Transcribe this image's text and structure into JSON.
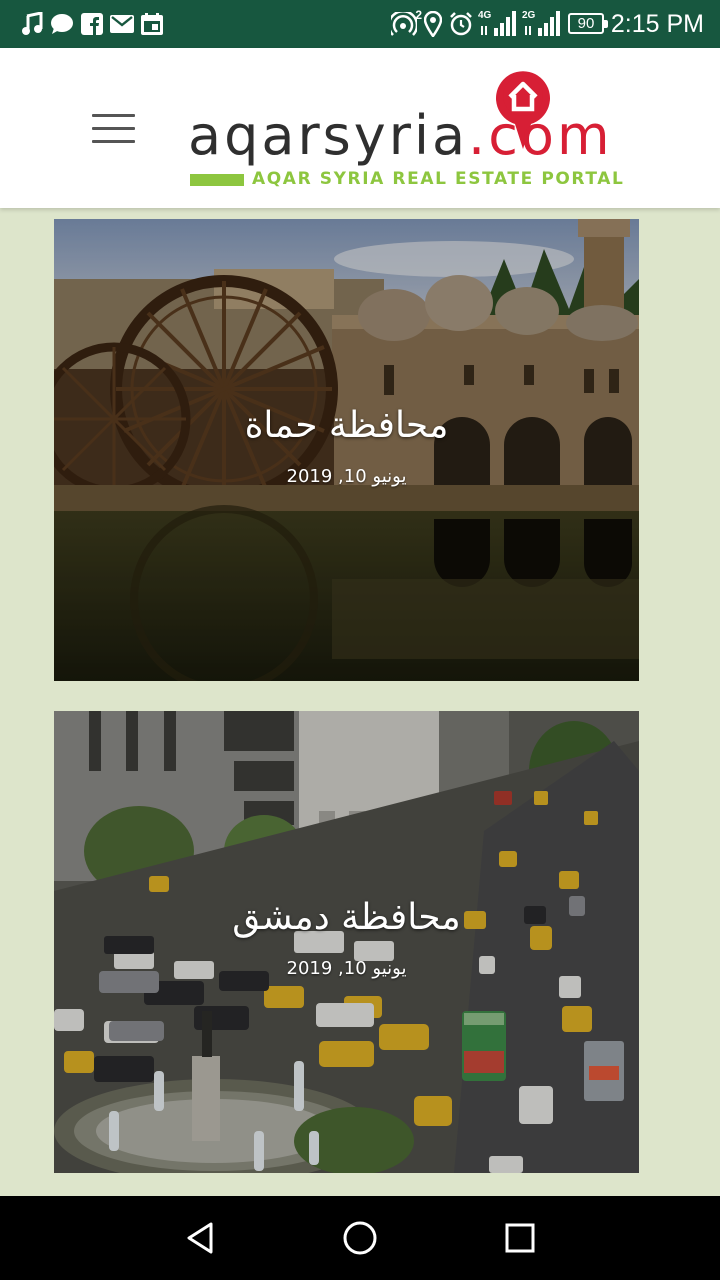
{
  "status_bar": {
    "time": "2:15 PM",
    "battery": "90",
    "signal_4g": "4G",
    "signal_2g": "2G",
    "hotspot_count": "2",
    "left_icons": [
      "music-icon",
      "chat-icon",
      "facebook-icon",
      "mail-icon",
      "calendar-icon"
    ],
    "right_icons": [
      "hotspot-icon",
      "location-icon",
      "alarm-icon",
      "signal-icon",
      "signal-icon",
      "battery-icon"
    ]
  },
  "header": {
    "menu_icon": "hamburger-menu-icon",
    "logo": {
      "main_before": "aqarsyria",
      "main_dot": ".",
      "main_after": "com",
      "tagline": "AQAR SYRIA REAL ESTATE PORTAL",
      "pin_icon": "house-pin-icon",
      "text_color": "#2f2f2f",
      "accent_red": "#d71f35",
      "accent_green": "#8dc63f"
    }
  },
  "posts": [
    {
      "title": "محافظة حماة",
      "date": "يونيو 10, 2019",
      "image": "hama-waterwheels-photo"
    },
    {
      "title": "محافظة دمشق",
      "date": "يونيو 10, 2019",
      "image": "damascus-street-photo"
    }
  ],
  "nav_bar": {
    "buttons": [
      "back-icon",
      "home-icon",
      "recents-icon"
    ]
  },
  "colors": {
    "status_bar": "#17573f",
    "page_background": "#dde5cb",
    "header_background": "#ffffff"
  }
}
